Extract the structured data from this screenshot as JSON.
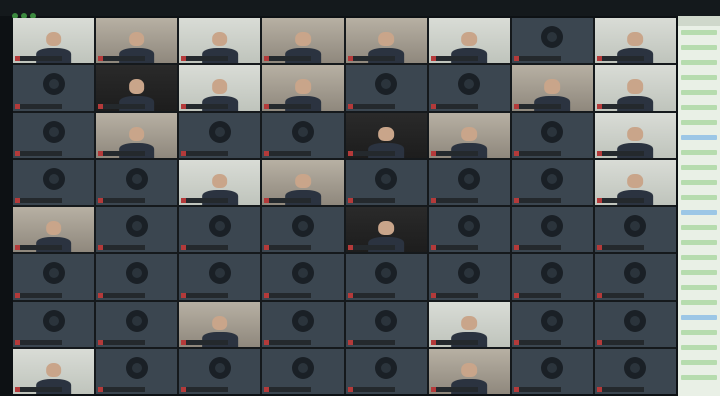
{
  "window": {
    "title": "",
    "speaker_label": ""
  },
  "grid": {
    "columns": 8,
    "rows": 8,
    "tiles": [
      {
        "type": "video",
        "variant": "light",
        "name": ""
      },
      {
        "type": "video",
        "variant": "room",
        "name": ""
      },
      {
        "type": "video",
        "variant": "light",
        "name": ""
      },
      {
        "type": "video",
        "variant": "room",
        "name": ""
      },
      {
        "type": "video",
        "variant": "room",
        "name": ""
      },
      {
        "type": "video",
        "variant": "light",
        "name": ""
      },
      {
        "type": "empty",
        "name": ""
      },
      {
        "type": "video",
        "variant": "light",
        "name": ""
      },
      {
        "type": "empty",
        "name": ""
      },
      {
        "type": "video",
        "variant": "dark",
        "name": ""
      },
      {
        "type": "video",
        "variant": "light",
        "name": ""
      },
      {
        "type": "video",
        "variant": "room",
        "name": ""
      },
      {
        "type": "empty",
        "name": ""
      },
      {
        "type": "empty",
        "name": ""
      },
      {
        "type": "video",
        "variant": "room",
        "name": ""
      },
      {
        "type": "video",
        "variant": "light",
        "name": ""
      },
      {
        "type": "empty",
        "name": ""
      },
      {
        "type": "video",
        "variant": "room",
        "name": ""
      },
      {
        "type": "empty",
        "name": ""
      },
      {
        "type": "empty",
        "name": ""
      },
      {
        "type": "video",
        "variant": "dark",
        "name": ""
      },
      {
        "type": "video",
        "variant": "room",
        "name": ""
      },
      {
        "type": "empty",
        "name": ""
      },
      {
        "type": "video",
        "variant": "light",
        "name": ""
      },
      {
        "type": "empty",
        "name": ""
      },
      {
        "type": "empty",
        "name": ""
      },
      {
        "type": "video",
        "variant": "light",
        "name": ""
      },
      {
        "type": "video",
        "variant": "room",
        "name": ""
      },
      {
        "type": "empty",
        "name": ""
      },
      {
        "type": "empty",
        "name": ""
      },
      {
        "type": "empty",
        "name": ""
      },
      {
        "type": "video",
        "variant": "light",
        "name": ""
      },
      {
        "type": "video",
        "variant": "room",
        "name": ""
      },
      {
        "type": "empty",
        "name": ""
      },
      {
        "type": "empty",
        "name": ""
      },
      {
        "type": "empty",
        "name": ""
      },
      {
        "type": "video",
        "variant": "dark",
        "name": ""
      },
      {
        "type": "empty",
        "name": ""
      },
      {
        "type": "empty",
        "name": ""
      },
      {
        "type": "empty",
        "name": ""
      },
      {
        "type": "empty",
        "name": ""
      },
      {
        "type": "empty",
        "name": ""
      },
      {
        "type": "empty",
        "name": ""
      },
      {
        "type": "empty",
        "name": ""
      },
      {
        "type": "empty",
        "name": ""
      },
      {
        "type": "empty",
        "name": ""
      },
      {
        "type": "empty",
        "name": ""
      },
      {
        "type": "empty",
        "name": ""
      },
      {
        "type": "empty",
        "name": ""
      },
      {
        "type": "empty",
        "name": ""
      },
      {
        "type": "video",
        "variant": "room",
        "name": ""
      },
      {
        "type": "empty",
        "name": ""
      },
      {
        "type": "empty",
        "name": ""
      },
      {
        "type": "video",
        "variant": "light",
        "name": ""
      },
      {
        "type": "empty",
        "name": ""
      },
      {
        "type": "empty",
        "name": ""
      },
      {
        "type": "video",
        "variant": "light",
        "name": ""
      },
      {
        "type": "empty",
        "name": ""
      },
      {
        "type": "empty",
        "name": ""
      },
      {
        "type": "empty",
        "name": ""
      },
      {
        "type": "empty",
        "name": ""
      },
      {
        "type": "video",
        "variant": "room",
        "name": ""
      },
      {
        "type": "empty",
        "name": ""
      },
      {
        "type": "empty",
        "name": ""
      }
    ]
  },
  "chat": {
    "messages": [
      {
        "style": "green"
      },
      {
        "style": "green"
      },
      {
        "style": "green"
      },
      {
        "style": "green"
      },
      {
        "style": "green"
      },
      {
        "style": "green"
      },
      {
        "style": "green"
      },
      {
        "style": "blue"
      },
      {
        "style": "green"
      },
      {
        "style": "green"
      },
      {
        "style": "green"
      },
      {
        "style": "green"
      },
      {
        "style": "blue"
      },
      {
        "style": "green"
      },
      {
        "style": "green"
      },
      {
        "style": "green"
      },
      {
        "style": "green"
      },
      {
        "style": "green"
      },
      {
        "style": "green"
      },
      {
        "style": "blue"
      },
      {
        "style": "green"
      },
      {
        "style": "green"
      },
      {
        "style": "green"
      },
      {
        "style": "green"
      }
    ]
  },
  "colors": {
    "mic_muted": "#b43a3a",
    "tile_background": "#3b4650",
    "chat_bubble": "#b6dcae",
    "chat_bubble_alt": "#9cc7e6"
  }
}
